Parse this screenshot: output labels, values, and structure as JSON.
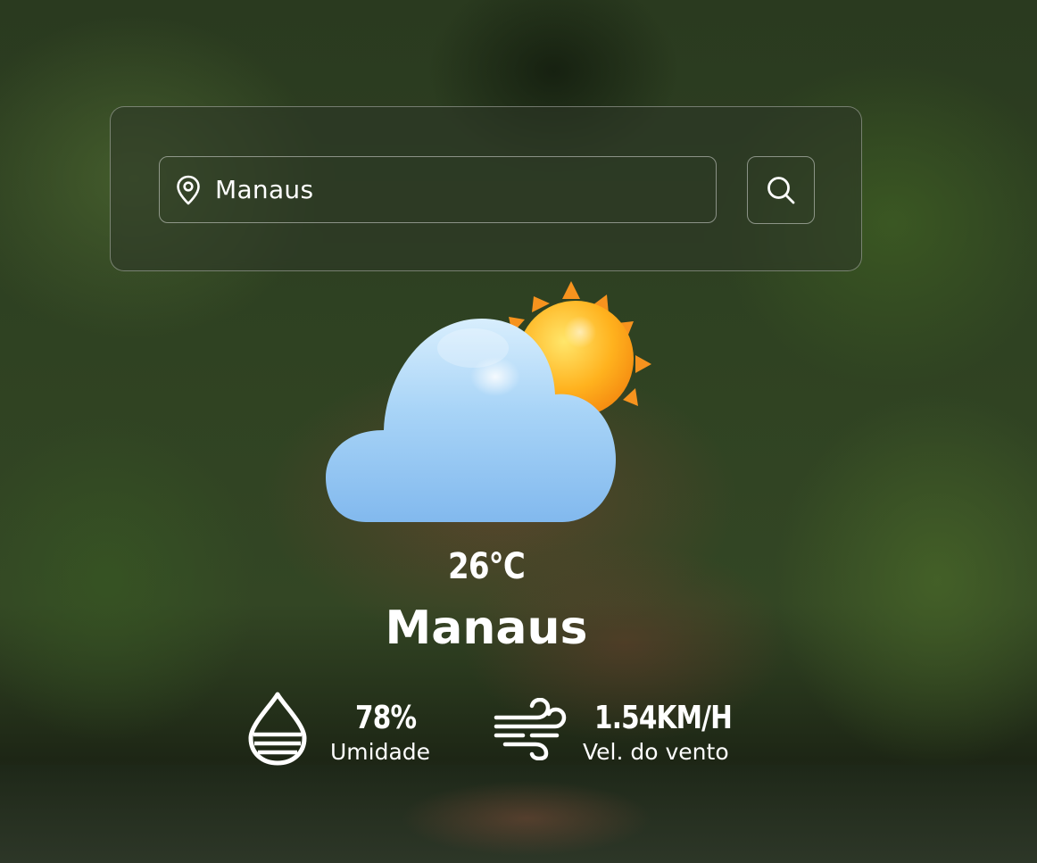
{
  "search": {
    "value": "Manaus",
    "pin_icon": "map-pin-icon",
    "button_icon": "search-icon"
  },
  "weather": {
    "icon": "partly-cloudy-icon",
    "temperature": "26°C",
    "city": "Manaus"
  },
  "stats": {
    "humidity": {
      "icon": "humidity-drop-icon",
      "value": "78%",
      "label": "Umidade"
    },
    "wind": {
      "icon": "wind-icon",
      "value": "1.54KM/H",
      "label": "Vel. do vento"
    }
  },
  "colors": {
    "sun": "#FFB21E",
    "cloud": "#9CCBF5",
    "text": "#FFFFFF"
  }
}
